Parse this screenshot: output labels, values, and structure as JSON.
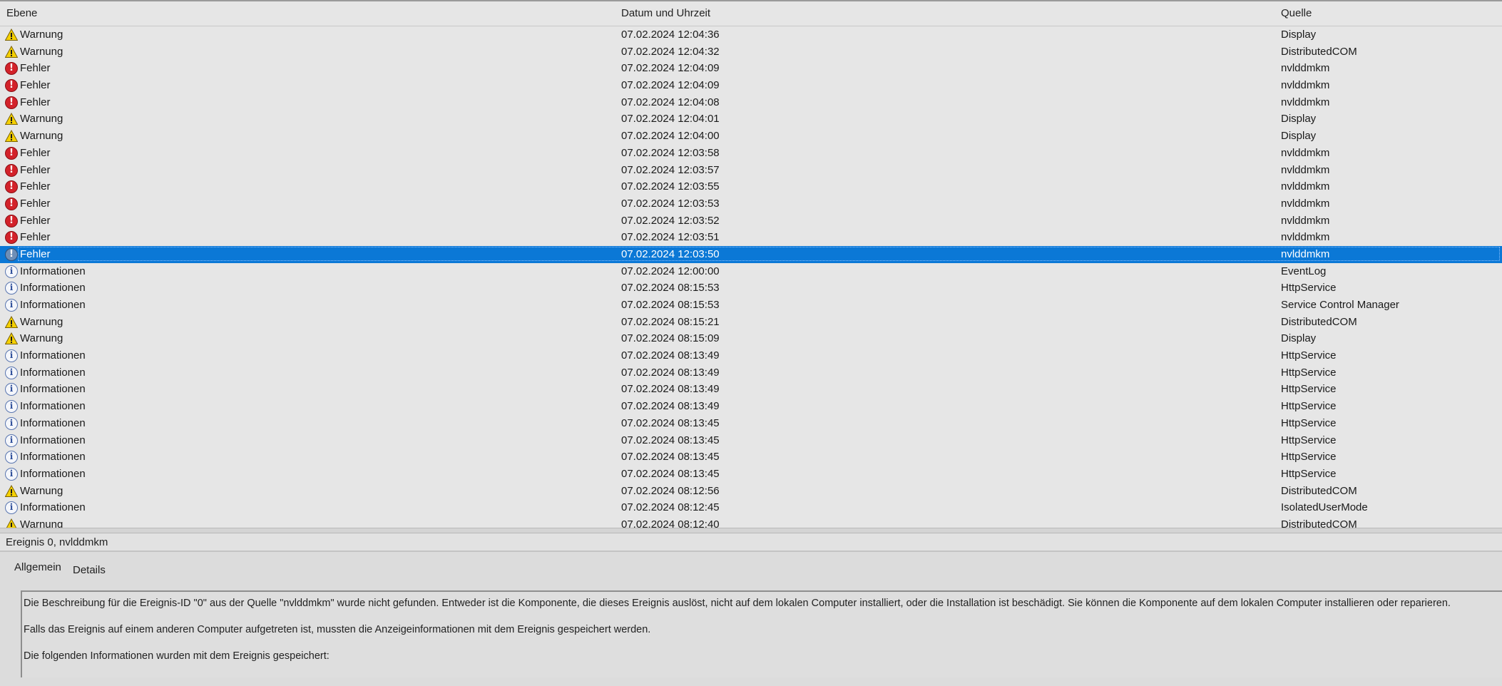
{
  "columns": {
    "level": "Ebene",
    "datetime": "Datum und Uhrzeit",
    "source": "Quelle"
  },
  "rows": [
    {
      "level": "Warnung",
      "type": "warn",
      "datetime": "07.02.2024 12:04:36",
      "source": "Display"
    },
    {
      "level": "Warnung",
      "type": "warn",
      "datetime": "07.02.2024 12:04:32",
      "source": "DistributedCOM"
    },
    {
      "level": "Fehler",
      "type": "error",
      "datetime": "07.02.2024 12:04:09",
      "source": "nvlddmkm"
    },
    {
      "level": "Fehler",
      "type": "error",
      "datetime": "07.02.2024 12:04:09",
      "source": "nvlddmkm"
    },
    {
      "level": "Fehler",
      "type": "error",
      "datetime": "07.02.2024 12:04:08",
      "source": "nvlddmkm"
    },
    {
      "level": "Warnung",
      "type": "warn",
      "datetime": "07.02.2024 12:04:01",
      "source": "Display"
    },
    {
      "level": "Warnung",
      "type": "warn",
      "datetime": "07.02.2024 12:04:00",
      "source": "Display"
    },
    {
      "level": "Fehler",
      "type": "error",
      "datetime": "07.02.2024 12:03:58",
      "source": "nvlddmkm"
    },
    {
      "level": "Fehler",
      "type": "error",
      "datetime": "07.02.2024 12:03:57",
      "source": "nvlddmkm"
    },
    {
      "level": "Fehler",
      "type": "error",
      "datetime": "07.02.2024 12:03:55",
      "source": "nvlddmkm"
    },
    {
      "level": "Fehler",
      "type": "error",
      "datetime": "07.02.2024 12:03:53",
      "source": "nvlddmkm"
    },
    {
      "level": "Fehler",
      "type": "error",
      "datetime": "07.02.2024 12:03:52",
      "source": "nvlddmkm"
    },
    {
      "level": "Fehler",
      "type": "error",
      "datetime": "07.02.2024 12:03:51",
      "source": "nvlddmkm"
    },
    {
      "level": "Fehler",
      "type": "error",
      "datetime": "07.02.2024 12:03:50",
      "source": "nvlddmkm",
      "selected": true
    },
    {
      "level": "Informationen",
      "type": "info",
      "datetime": "07.02.2024 12:00:00",
      "source": "EventLog"
    },
    {
      "level": "Informationen",
      "type": "info",
      "datetime": "07.02.2024 08:15:53",
      "source": "HttpService"
    },
    {
      "level": "Informationen",
      "type": "info",
      "datetime": "07.02.2024 08:15:53",
      "source": "Service Control Manager"
    },
    {
      "level": "Warnung",
      "type": "warn",
      "datetime": "07.02.2024 08:15:21",
      "source": "DistributedCOM"
    },
    {
      "level": "Warnung",
      "type": "warn",
      "datetime": "07.02.2024 08:15:09",
      "source": "Display"
    },
    {
      "level": "Informationen",
      "type": "info",
      "datetime": "07.02.2024 08:13:49",
      "source": "HttpService"
    },
    {
      "level": "Informationen",
      "type": "info",
      "datetime": "07.02.2024 08:13:49",
      "source": "HttpService"
    },
    {
      "level": "Informationen",
      "type": "info",
      "datetime": "07.02.2024 08:13:49",
      "source": "HttpService"
    },
    {
      "level": "Informationen",
      "type": "info",
      "datetime": "07.02.2024 08:13:49",
      "source": "HttpService"
    },
    {
      "level": "Informationen",
      "type": "info",
      "datetime": "07.02.2024 08:13:45",
      "source": "HttpService"
    },
    {
      "level": "Informationen",
      "type": "info",
      "datetime": "07.02.2024 08:13:45",
      "source": "HttpService"
    },
    {
      "level": "Informationen",
      "type": "info",
      "datetime": "07.02.2024 08:13:45",
      "source": "HttpService"
    },
    {
      "level": "Informationen",
      "type": "info",
      "datetime": "07.02.2024 08:13:45",
      "source": "HttpService"
    },
    {
      "level": "Warnung",
      "type": "warn",
      "datetime": "07.02.2024 08:12:56",
      "source": "DistributedCOM"
    },
    {
      "level": "Informationen",
      "type": "info",
      "datetime": "07.02.2024 08:12:45",
      "source": "IsolatedUserMode"
    },
    {
      "level": "Warnung",
      "type": "warn",
      "datetime": "07.02.2024 08:12:40",
      "source": "DistributedCOM"
    }
  ],
  "event": {
    "title": "Ereignis 0, nvlddmkm",
    "tabs": [
      "Allgemein",
      "Details"
    ],
    "description": [
      "Die Beschreibung für die Ereignis-ID \"0\" aus der Quelle \"nvlddmkm\" wurde nicht gefunden. Entweder ist die Komponente, die dieses Ereignis auslöst, nicht auf dem lokalen Computer installiert, oder die Installation ist beschädigt. Sie können die Komponente auf dem lokalen Computer installieren oder reparieren.",
      "Falls das Ereignis auf einem anderen Computer aufgetreten ist, mussten die Anzeigeinformationen mit dem Ereignis gespeichert werden.",
      "Die folgenden Informationen wurden mit dem Ereignis gespeichert:"
    ]
  },
  "colors": {
    "selection": "#0b78d6",
    "error": "#d3222a",
    "warning": "#f5d000",
    "info": "#5a76b0"
  },
  "icons": {
    "warn": "warning-icon",
    "error": "error-icon",
    "info": "info-icon"
  }
}
